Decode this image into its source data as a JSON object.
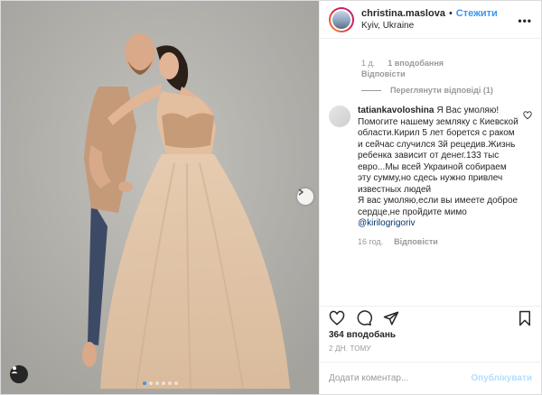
{
  "header": {
    "username": "christina.maslova",
    "separator": "•",
    "follow_label": "Стежити",
    "location": "Kyiv, Ukraine",
    "more_label": "•••"
  },
  "prev_comment": {
    "age": "1 д.",
    "likes": "1 вподобання",
    "reply": "Відповісти",
    "view_replies": "Переглянути відповіді (1)"
  },
  "comment": {
    "username": "tatiankavoloshina",
    "text": "Я Вас умоляю! Помогите нашему земляку с Киевской области.Кирил 5 лет борется с раком и сейчас случился 3й рецедив.Жизнь ребенка зависит от денег.133 тыс евро...Мы всей Украиной собираем эту сумму,но сдесь нужно привлеч известных людей\nЯ вас умоляю,если вы имеете доброе сердце,не пройдите мимо ",
    "mention": "@kirilogrigoriv",
    "age": "16 год.",
    "reply": "Відповісти"
  },
  "post": {
    "likes": "364 вподобань",
    "date": "2 ДН. ТОМУ",
    "comment_placeholder": "Додати коментар...",
    "publish_label": "Опублікувати"
  },
  "carousel": {
    "dots": 6,
    "active_index": 0
  },
  "colors": {
    "accent": "#3897f0",
    "publish_disabled": "#b2dffc",
    "muted": "#999999"
  }
}
